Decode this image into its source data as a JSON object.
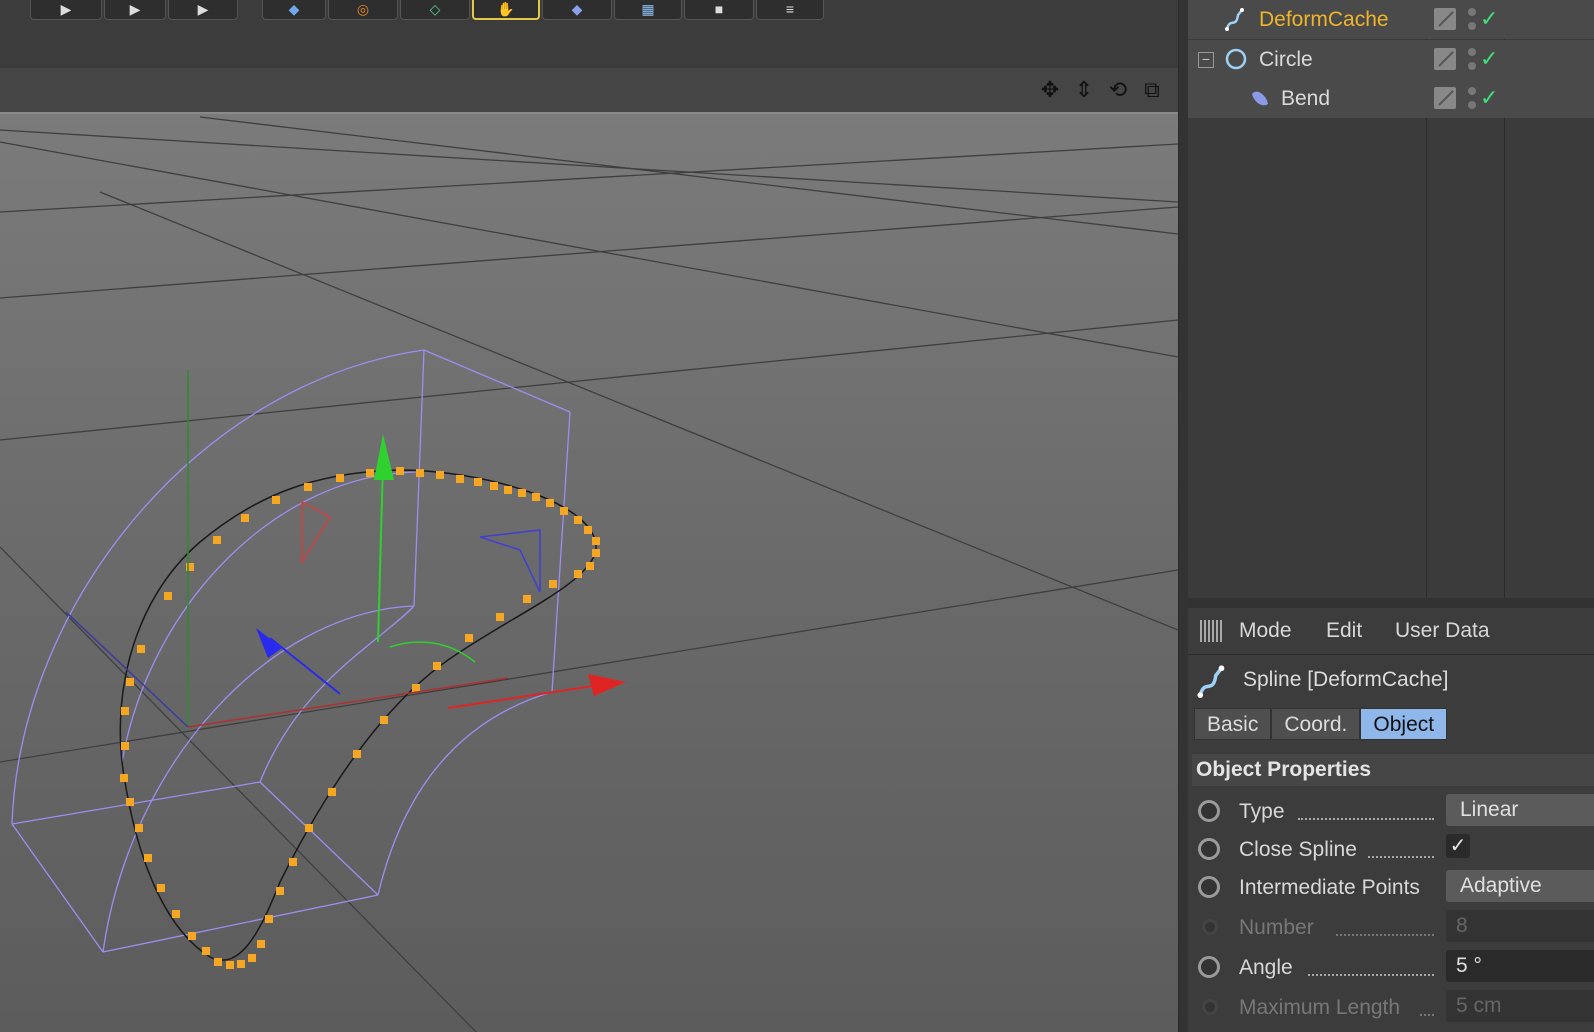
{
  "colors": {
    "accent": "#8fb7ea",
    "selected_object": "#f0b429",
    "check": "#3ee07a",
    "spline_points": "#f5a623",
    "bend_cage": "#9b8ff0"
  },
  "toolbar": {
    "icons": [
      "play-forward-icon",
      "play-forward-icon",
      "play-forward-icon",
      "cube-icon",
      "scale-icon",
      "polygon-icon",
      "point-mode-icon",
      "cube-object-icon",
      "floor-grid-icon",
      "camera-icon",
      "menu-icon"
    ]
  },
  "viewport": {
    "nav_icons": [
      "move-view-icon",
      "zoom-view-icon",
      "rotate-view-icon",
      "maximize-view-icon"
    ]
  },
  "object_manager": {
    "objects": [
      {
        "name": "DeformCache",
        "icon": "spline-icon",
        "selected": true,
        "depth": 1
      },
      {
        "name": "Circle",
        "icon": "circle-icon",
        "selected": false,
        "depth": 0
      },
      {
        "name": "Bend",
        "icon": "bend-deformer-icon",
        "selected": false,
        "depth": 1
      }
    ]
  },
  "attributes": {
    "menu": [
      "Mode",
      "Edit",
      "User Data"
    ],
    "title": "Spline [DeformCache]",
    "tabs": [
      {
        "label": "Basic",
        "active": false
      },
      {
        "label": "Coord.",
        "active": false
      },
      {
        "label": "Object",
        "active": true
      }
    ],
    "section": "Object Properties",
    "props": {
      "type": {
        "label": "Type",
        "value": "Linear"
      },
      "close_spline": {
        "label": "Close Spline",
        "checked": true,
        "mark": "✓"
      },
      "intermediate": {
        "label": "Intermediate Points",
        "value": "Adaptive"
      },
      "number": {
        "label": "Number",
        "value": "8"
      },
      "angle": {
        "label": "Angle",
        "value": "5 °"
      },
      "max_length": {
        "label": "Maximum Length",
        "value": "5 cm"
      }
    }
  }
}
